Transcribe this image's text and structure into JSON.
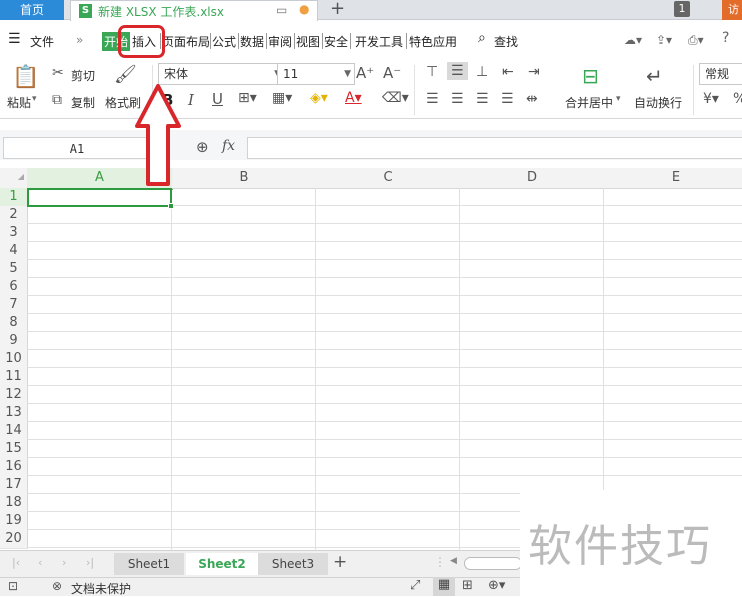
{
  "titlebar": {
    "home_tab": "首页",
    "doc_icon": "S",
    "doc_title": "新建 XLSX 工作表.xlsx",
    "new_tab": "+",
    "badge": "1",
    "visit": "访"
  },
  "menu": {
    "file": "文件",
    "items": [
      "开始",
      "插入",
      "页面布局",
      "公式",
      "数据",
      "审阅",
      "视图",
      "安全",
      "开发工具",
      "特色应用"
    ],
    "search": "查找"
  },
  "ribbon": {
    "paste": "粘贴",
    "cut": "剪切",
    "copy": "复制",
    "format_painter": "格式刷",
    "font_name": "宋体",
    "font_size": "11",
    "merge_center": "合并居中",
    "wrap_text": "自动换行",
    "number_format": "常规"
  },
  "formula_bar": {
    "cell_ref": "A1",
    "fx": "fx",
    "formula": ""
  },
  "grid": {
    "columns": [
      "A",
      "B",
      "C",
      "D",
      "E"
    ],
    "rows": [
      "1",
      "2",
      "3",
      "4",
      "5",
      "6",
      "7",
      "8",
      "9",
      "10",
      "11",
      "12",
      "13",
      "14",
      "15",
      "16",
      "17",
      "18",
      "19",
      "20"
    ],
    "selected_cell": "A1"
  },
  "sheets": [
    "Sheet1",
    "Sheet2",
    "Sheet3"
  ],
  "active_sheet": "Sheet2",
  "status": {
    "protection": "文档未保护"
  },
  "watermark": "软件技巧",
  "colors": {
    "accent_green": "#3aa756",
    "annotation_red": "#d8262b",
    "home_tab_blue": "#2b8bd8"
  }
}
